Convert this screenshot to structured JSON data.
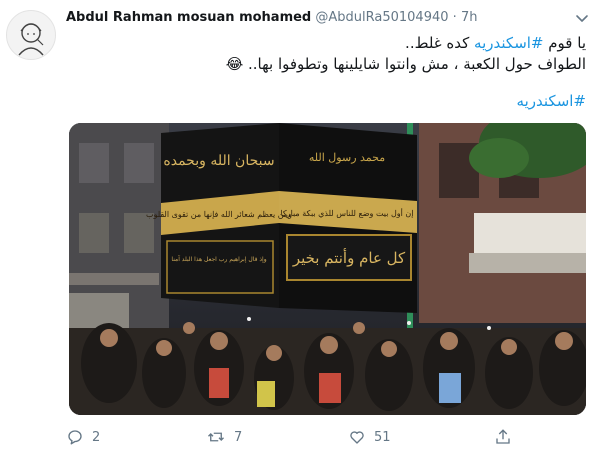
{
  "tweet": {
    "author_name": "Abdul Rahman mosuan mohamed",
    "handle": "@AbdulRa50104940",
    "separator": "·",
    "time": "7h",
    "line1_prefix": "يا قوم ",
    "line1_hashtag": "#اسكندريه",
    "line1_suffix": " كده غلط..",
    "line2_text": "الطواف حول الكعبة ، مش وانتوا شايلينها وتطوفوا بها..",
    "line2_emoji": "😂",
    "line3_hashtag": "#اسكندريه"
  },
  "media": {
    "cloth_texts": {
      "front_top": "سبحان الله وبحمده",
      "side_top": "محمد رسول الله",
      "front_belt": "ومن يعظم شعائر الله فإنها من تقوى القلوب",
      "side_belt": "إن أول بيت وضع للناس للذي ببكة مباركا",
      "front_body": "وإذ قال إبراهيم رب اجعل هذا البلد آمنا",
      "side_body": "كل عام وأنتم بخير"
    }
  },
  "actions": {
    "replies": "2",
    "retweets": "7",
    "likes": "51"
  },
  "colors": {
    "hashtag": "#1b95e0",
    "meta": "#657786",
    "text": "#14171a"
  },
  "icons": [
    "avatar-sketch",
    "chevron-down-icon",
    "reply-icon",
    "retweet-icon",
    "like-icon",
    "share-icon"
  ]
}
